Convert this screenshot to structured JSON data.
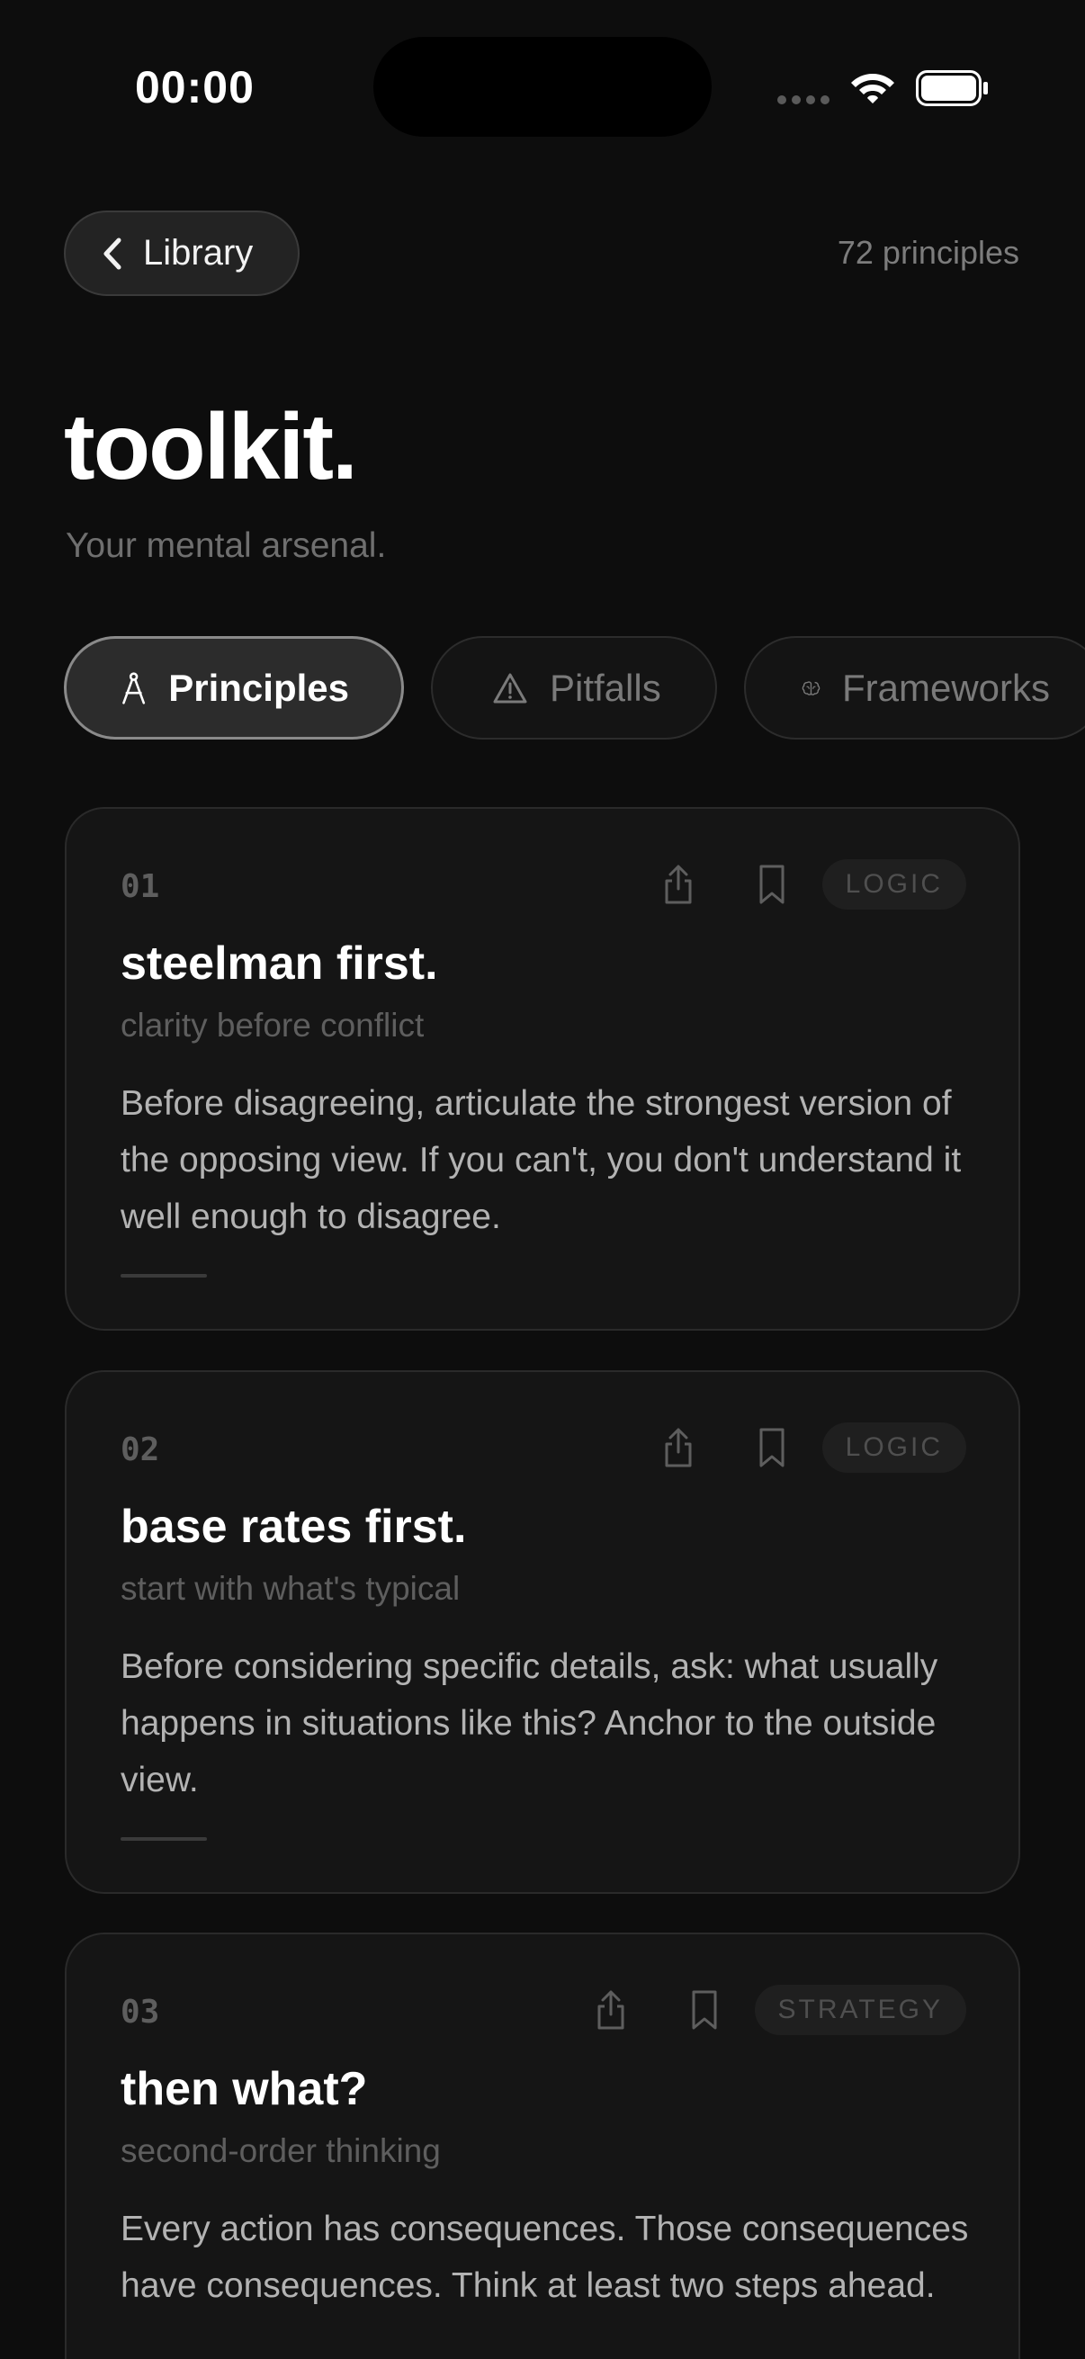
{
  "status_bar": {
    "time": "00:00"
  },
  "header": {
    "back_label": "Library",
    "count_label": "72 principles"
  },
  "page": {
    "title": "toolkit.",
    "subtitle": "Your mental arsenal."
  },
  "tabs": [
    {
      "label": "Principles",
      "icon": "compass-icon",
      "active": true
    },
    {
      "label": "Pitfalls",
      "icon": "warning-icon",
      "active": false
    },
    {
      "label": "Frameworks",
      "icon": "brain-icon",
      "active": false
    }
  ],
  "cards": [
    {
      "number": "01",
      "category": "LOGIC",
      "title": "steelman first.",
      "subtitle": "clarity before conflict",
      "body": "Before disagreeing, articulate the strongest version of the opposing view. If you can't, you don't understand it well enough to disagree."
    },
    {
      "number": "02",
      "category": "LOGIC",
      "title": "base rates first.",
      "subtitle": "start with what's typical",
      "body": "Before considering specific details, ask: what usually happens in situations like this? Anchor to the outside view."
    },
    {
      "number": "03",
      "category": "STRATEGY",
      "title": "then what?",
      "subtitle": "second-order thinking",
      "body": "Every action has consequences. Those consequences have consequences. Think at least two steps ahead."
    }
  ],
  "colors": {
    "background": "#0d0d0d",
    "card": "#151515",
    "text_primary": "#ffffff",
    "text_muted": "#5e5e5e"
  }
}
